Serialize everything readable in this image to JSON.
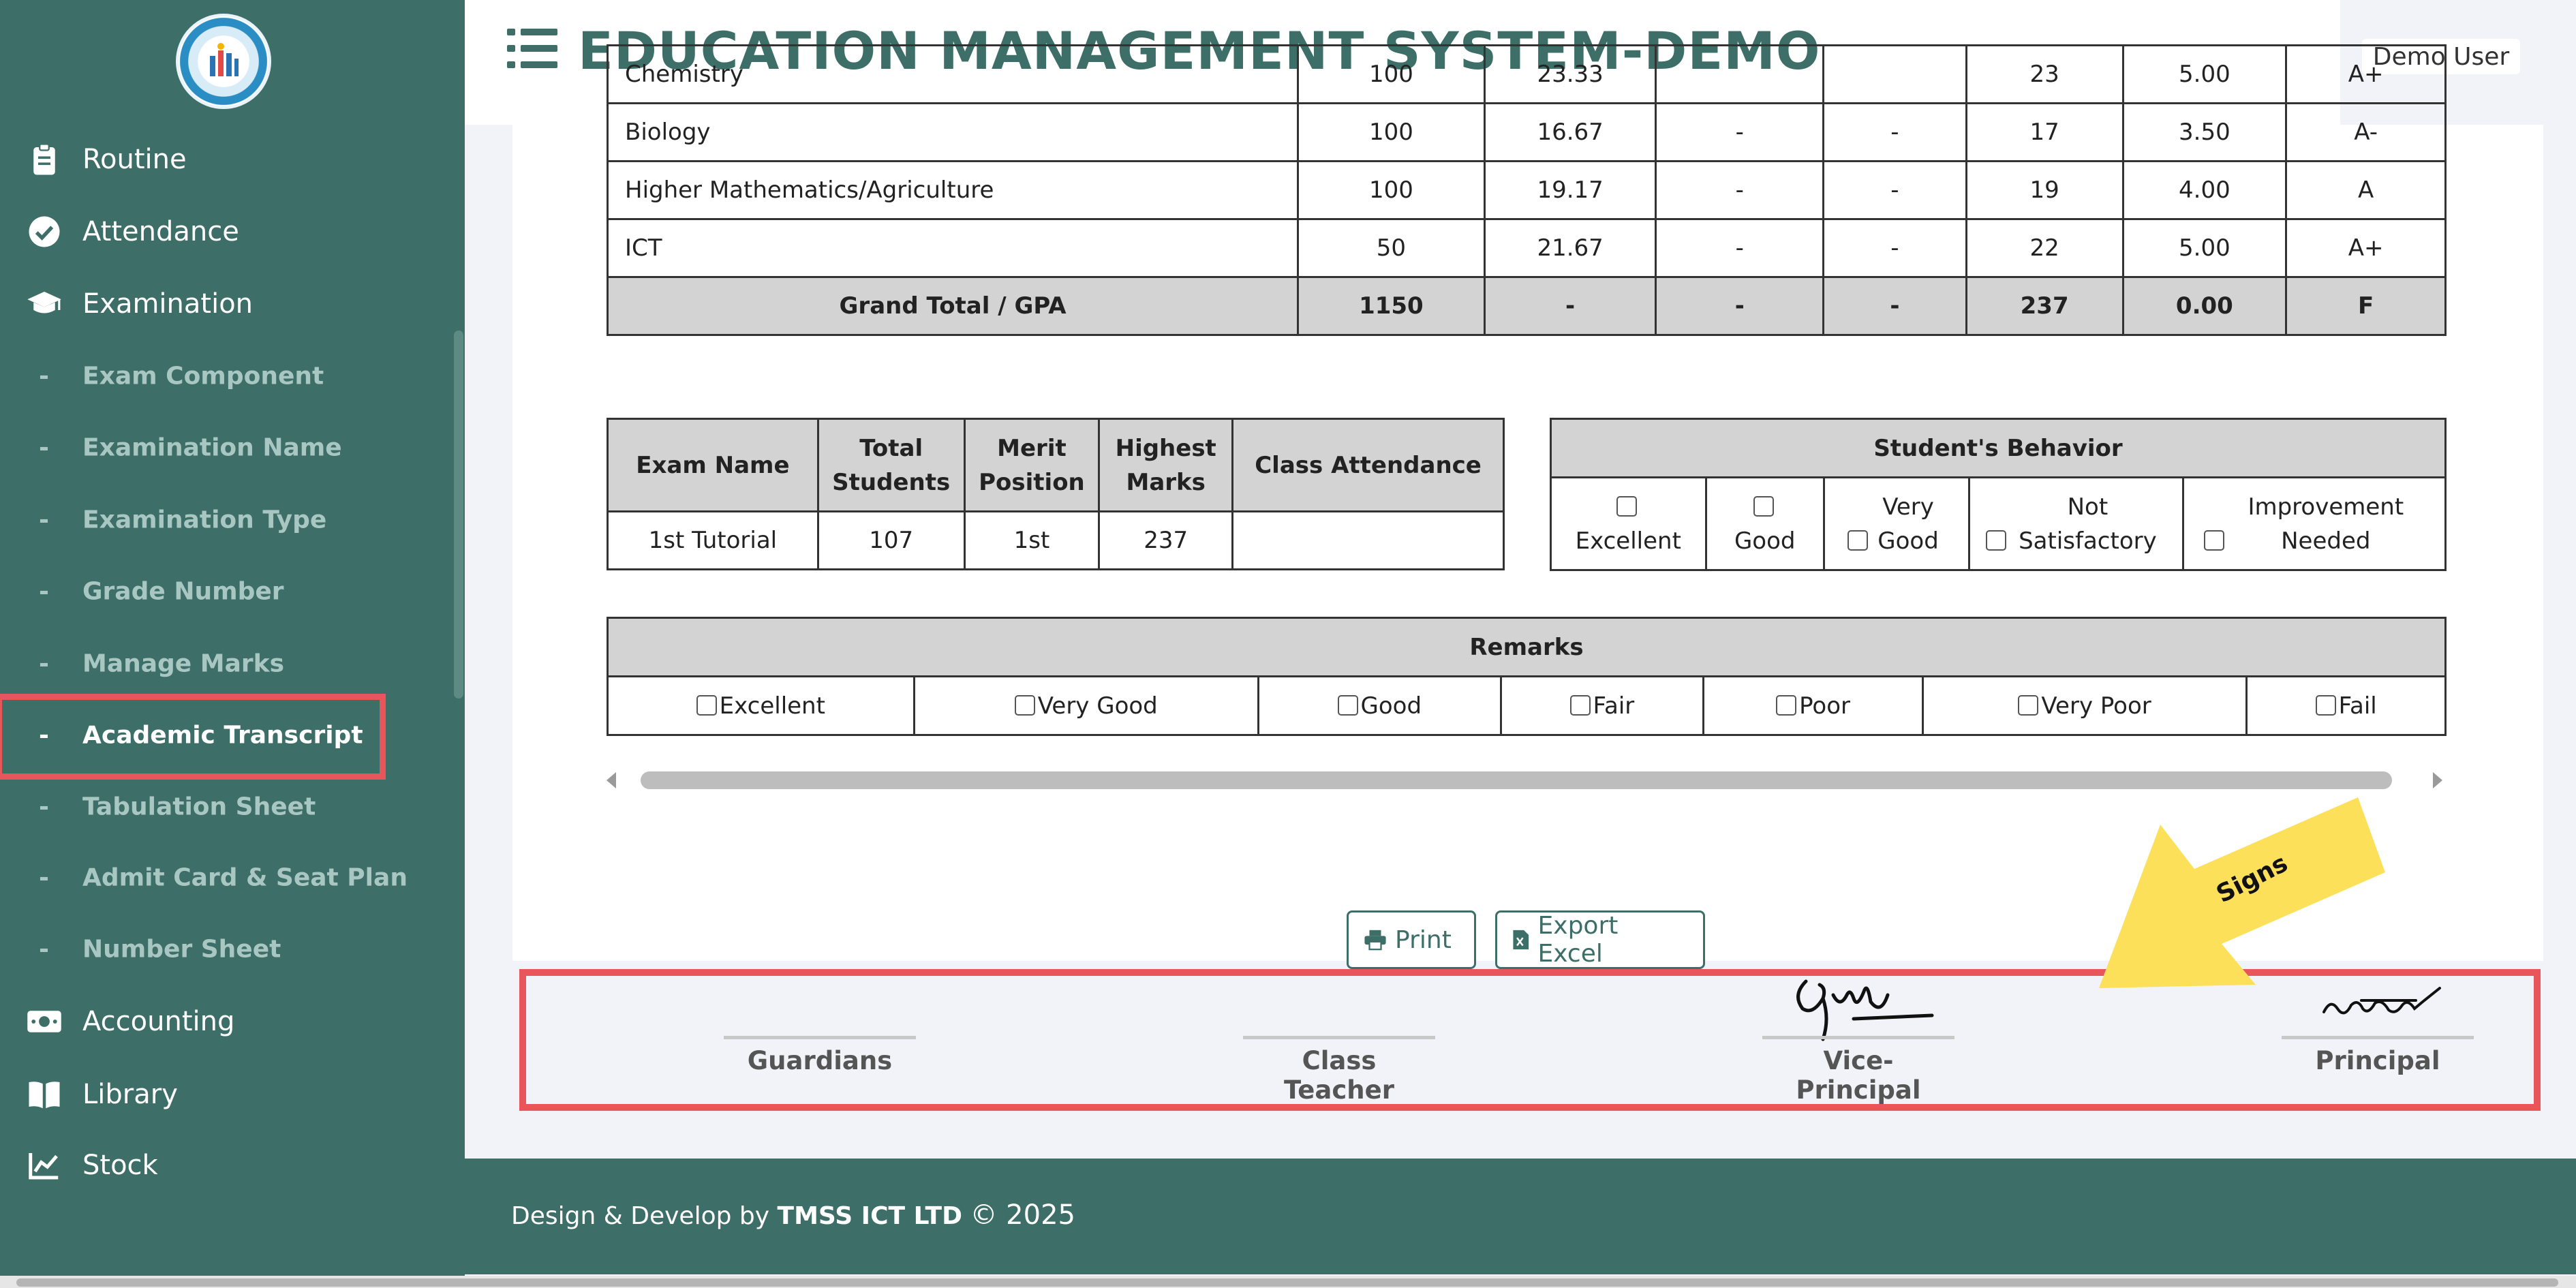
{
  "header": {
    "title": "EDUCATION MANAGEMENT SYSTEM-DEMO",
    "user": "Demo User"
  },
  "sidebar": {
    "items": [
      {
        "label": "Routine",
        "icon": "clipboard-icon"
      },
      {
        "label": "Attendance",
        "icon": "check-circle-icon"
      },
      {
        "label": "Examination",
        "icon": "graduation-cap-icon"
      }
    ],
    "examination_sub": [
      "Exam Component",
      "Examination Name",
      "Examination Type",
      "Grade Number",
      "Manage Marks",
      "Academic Transcript",
      "Tabulation Sheet",
      "Admit Card & Seat Plan",
      "Number Sheet"
    ],
    "active_sub": "Academic Transcript",
    "bottom_items": [
      {
        "label": "Accounting",
        "icon": "money-icon"
      },
      {
        "label": "Library",
        "icon": "book-icon"
      },
      {
        "label": "Stock",
        "icon": "chart-line-icon"
      }
    ]
  },
  "marks_table": {
    "rows": [
      [
        "Chemistry",
        "100",
        "23.33",
        "",
        "",
        "23",
        "5.00",
        "A+"
      ],
      [
        "Biology",
        "100",
        "16.67",
        "-",
        "-",
        "17",
        "3.50",
        "A-"
      ],
      [
        "Higher Mathematics/Agriculture",
        "100",
        "19.17",
        "-",
        "-",
        "19",
        "4.00",
        "A"
      ],
      [
        "ICT",
        "50",
        "21.67",
        "-",
        "-",
        "22",
        "5.00",
        "A+"
      ]
    ],
    "total": [
      "Grand Total / GPA",
      "1150",
      "-",
      "-",
      "-",
      "237",
      "0.00",
      "F"
    ]
  },
  "exam_summary": {
    "headers": [
      "Exam Name",
      "Total Students",
      "Merit Position",
      "Highest Marks",
      "Class Attendance"
    ],
    "row": [
      "1st Tutorial",
      "107",
      "1st",
      "237",
      ""
    ]
  },
  "behavior": {
    "title": "Student's Behavior",
    "options": [
      "Excellent",
      "Good",
      "Very Good",
      "Not Satisfactory",
      "Improvement Needed"
    ]
  },
  "remarks": {
    "title": "Remarks",
    "options": [
      "Excellent",
      "Very Good",
      "Good",
      "Fair",
      "Poor",
      "Very Poor",
      "Fail"
    ]
  },
  "buttons": {
    "print": "Print",
    "export": "Export Excel"
  },
  "signatures": [
    "Guardians",
    "Class Teacher",
    "Vice-Principal",
    "Principal"
  ],
  "annotation": {
    "arrow_label": "Signs"
  },
  "footer": {
    "prefix": "Design & Develop by",
    "company": "TMSS ICT LTD",
    "copyright": "© 2025"
  },
  "colors": {
    "primary": "#3d6e67",
    "highlight": "#e8555a",
    "arrow": "#fde05a"
  }
}
